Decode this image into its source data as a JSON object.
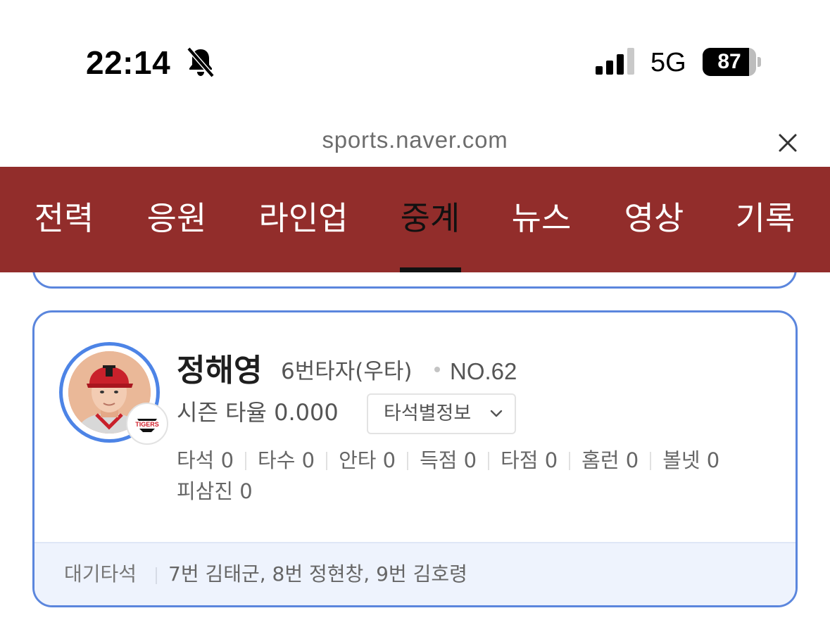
{
  "status_bar": {
    "time": "22:14",
    "network": "5G",
    "battery": {
      "level_text": "87",
      "level_fraction": 0.87
    },
    "icons": [
      "bell-muted-icon",
      "signal-icon",
      "battery-icon"
    ]
  },
  "browser": {
    "url": "sports.naver.com",
    "close_icon": "close-icon"
  },
  "nav": {
    "tabs": [
      {
        "label": "전력",
        "active": false
      },
      {
        "label": "응원",
        "active": false
      },
      {
        "label": "라인업",
        "active": false
      },
      {
        "label": "중계",
        "active": true
      },
      {
        "label": "뉴스",
        "active": false
      },
      {
        "label": "영상",
        "active": false
      },
      {
        "label": "기록",
        "active": false
      }
    ],
    "background_color": "#922d2b"
  },
  "batter": {
    "name": "정해영",
    "order": "6번타자(우타)",
    "number": "NO.62",
    "season_avg": "시즌 타율 0.000",
    "at_bat_button": "타석별정보",
    "team_logo_text": "TIGERS",
    "stats": [
      "타석 0",
      "타수 0",
      "안타 0",
      "득점 0",
      "타점 0",
      "홈런 0",
      "볼넷 0",
      "피삼진 0"
    ],
    "waiting": {
      "label": "대기타석",
      "value": "7번 김태군, 8번 정현창, 9번 김호령"
    }
  },
  "colors": {
    "card_border": "#5b86dd",
    "footer_bg": "#eef3fd",
    "avatar_ring": "#4d84e6"
  }
}
